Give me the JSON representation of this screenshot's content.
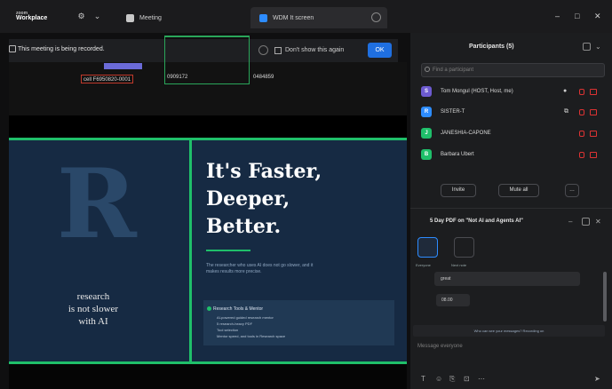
{
  "app": {
    "brand_line1": "zoom",
    "brand_line2": "Workplace"
  },
  "tabs": [
    {
      "label": "Meeting",
      "icon": "meeting-icon",
      "color": "#c8c8c8"
    },
    {
      "label": "WDM It screen",
      "icon": "share-screen-icon",
      "color": "#2d8cff"
    }
  ],
  "recording": {
    "notice": "This meeting is being recorded.",
    "dont_show": "Don't show this again",
    "ok_label": "OK"
  },
  "shared_screen": {
    "highlight_tag": "",
    "cells": [
      "cell F6950820-0001",
      "0909172",
      "0484859"
    ]
  },
  "slide": {
    "logo_letter": "R",
    "tagline": [
      "research",
      "is not slower",
      "with AI"
    ],
    "headline": [
      "It's Faster,",
      "Deeper,",
      "Better."
    ],
    "subtext": "The researcher who uses AI does not go slower, and it makes results more precise.",
    "cta_title": "Research Tools & Mentor",
    "cta_lines": [
      "AI-powered guided research mentor",
      "5 research-heavy PDF",
      "Tool selection",
      "Mentor speed, and tools in Research space"
    ],
    "accent": "#1fbf6a",
    "background": "#162a43"
  },
  "participants": {
    "title": "Participants (5)",
    "search_placeholder": "Find a participant",
    "list": [
      {
        "initial": "S",
        "name": "Tom Mongul (HOST, Host, me)",
        "color": "#6d5bd0"
      },
      {
        "initial": "R",
        "name": "SISTER-T",
        "color": "#2d8cff"
      },
      {
        "initial": "J",
        "name": "JANESHIA-CAPONE",
        "color": "#1fbf6a"
      },
      {
        "initial": "B",
        "name": "Barbara Ubert",
        "color": "#1fbf6a"
      }
    ],
    "invite_label": "Invite",
    "mute_all_label": "Mute all"
  },
  "chat": {
    "title": "5 Day PDF on \"Not AI and Agents AI\"",
    "tools": [
      "Everyone",
      "Next note"
    ],
    "cards": [
      "great",
      "08.00"
    ],
    "hint": "Who can see your messages? Recording on",
    "input_placeholder": "Message everyone"
  }
}
